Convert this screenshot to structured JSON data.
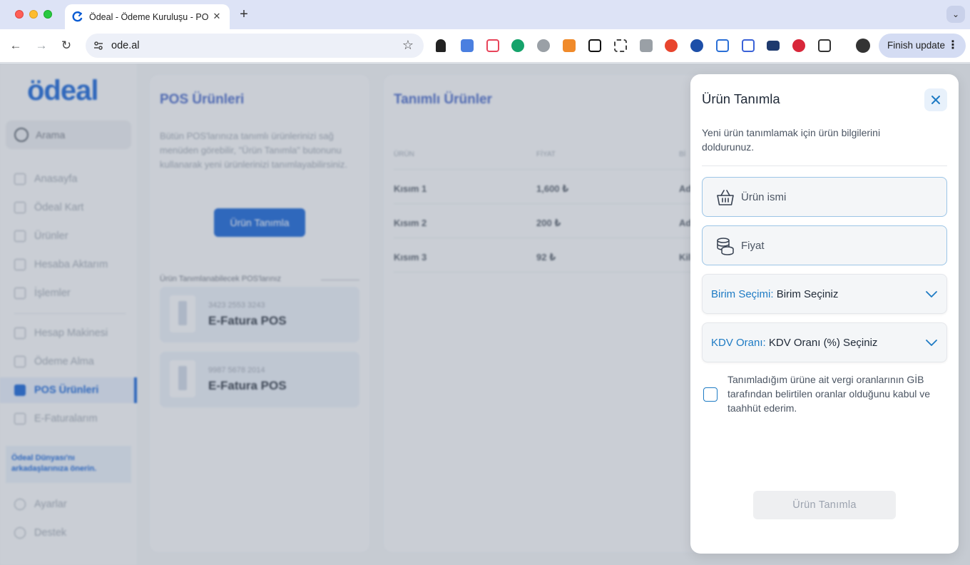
{
  "browser": {
    "tab_title": "Ödeal - Ödeme Kuruluşu - PO",
    "url": "ode.al",
    "finish_update": "Finish update"
  },
  "sidebar": {
    "logo": "ödeal",
    "search": "Arama",
    "items": [
      {
        "label": "Anasayfa"
      },
      {
        "label": "Ödeal Kart"
      },
      {
        "label": "Ürünler"
      },
      {
        "label": "Hesaba Aktarım"
      },
      {
        "label": "İşlemler"
      },
      {
        "label": "Hesap Makinesi"
      },
      {
        "label": "Ödeme Alma"
      },
      {
        "label": "POS Ürünleri"
      },
      {
        "label": "E-Faturalarım"
      },
      {
        "label": "Ayarlar"
      },
      {
        "label": "Destek"
      }
    ],
    "promo": "Ödeal Dünyası'nı arkadaşlarınıza önerin."
  },
  "pos_card": {
    "title": "POS Ürünleri",
    "description": "Bütün POS'larınıza tanımlı ürünlerinizi sağ menüden görebilir, \"Ürün Tanımla\" butonunu kullanarak yeni ürünlerinizi tanımlayabilirsiniz.",
    "button": "Ürün Tanımla",
    "subheading": "Ürün Tanımlanabilecek POS'larınız",
    "devices": [
      {
        "serial": "3423 2553 3243",
        "name": "E-Fatura POS"
      },
      {
        "serial": "9987 5678 2014",
        "name": "E-Fatura POS"
      }
    ]
  },
  "products_card": {
    "title": "Tanımlı Ürünler",
    "headers": [
      "ÜRÜN",
      "FİYAT",
      "Bİ"
    ],
    "rows": [
      {
        "name": "Kısım 1",
        "price": "1,600 ₺",
        "unit": "Ad"
      },
      {
        "name": "Kısım 2",
        "price": "200 ₺",
        "unit": "Ad"
      },
      {
        "name": "Kısım 3",
        "price": "92 ₺",
        "unit": "Kil"
      }
    ]
  },
  "modal": {
    "title": "Ürün Tanımla",
    "description": "Yeni ürün tanımlamak için ürün bilgilerini doldurunuz.",
    "name_placeholder": "Ürün ismi",
    "price_placeholder": "Fiyat",
    "unit_label": "Birim Seçimi:",
    "unit_value": "Birim Seçiniz",
    "kdv_label": "KDV Oranı:",
    "kdv_value": "KDV Oranı (%) Seçiniz",
    "consent": "Tanımladığım ürüne ait vergi oranlarının GİB tarafından belirtilen oranlar olduğunu kabul ve taahhüt ederim.",
    "submit": "Ürün Tanımla"
  },
  "colors": {
    "brand": "#0a5bd3",
    "accent": "#1e7bc4"
  }
}
